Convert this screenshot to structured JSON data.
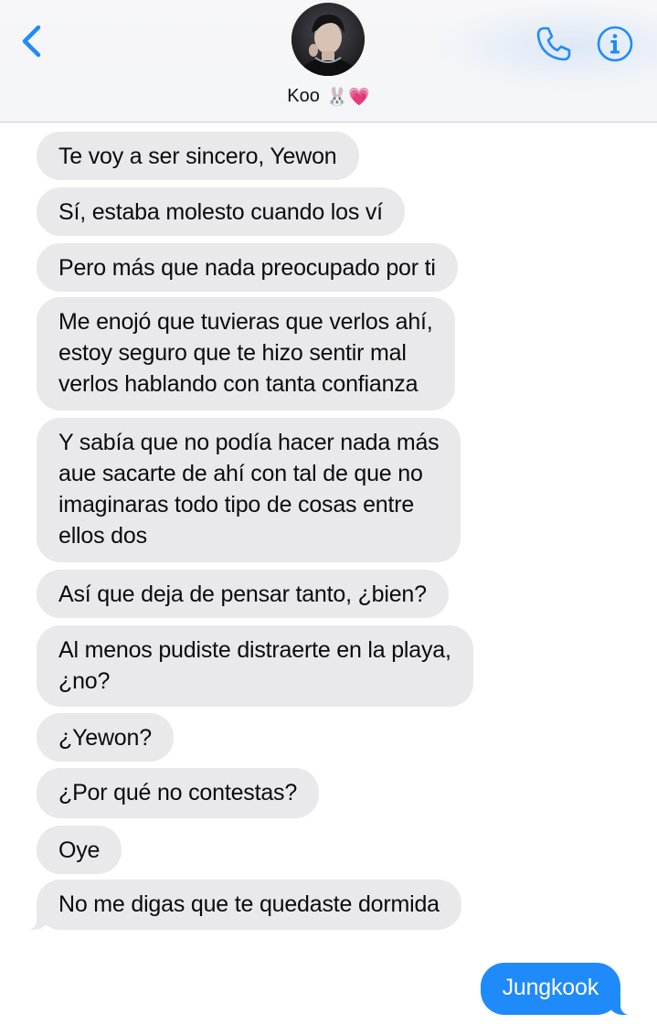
{
  "header": {
    "contact_name": "Koo",
    "contact_emojis": "🐰💗",
    "back_icon": "chevron-left-icon",
    "call_icon": "phone-icon",
    "info_icon": "info-icon",
    "accent_color": "#1f8bfa"
  },
  "messages": [
    {
      "text": "Te voy a ser sincero, Yewon"
    },
    {
      "text": "Sí, estaba molesto cuando los ví"
    },
    {
      "text": "Pero más que nada preocupado por ti"
    },
    {
      "text": "Me enojó que tuvieras que verlos ahí,\nestoy seguro que te hizo sentir mal\nverlos hablando con tanta confianza"
    },
    {
      "text": "Y sabía que no podía hacer nada más\naue sacarte de ahí con tal de que no\nimaginaras todo tipo de cosas entre\nellos dos"
    },
    {
      "text": "Así que deja de pensar tanto, ¿bien?"
    },
    {
      "text": "Al menos pudiste distraerte en la playa,\n¿no?"
    },
    {
      "text": "¿Yewon?"
    },
    {
      "text": "¿Por qué no contestas?"
    },
    {
      "text": "Oye"
    },
    {
      "text": "No me digas que te quedaste dormida"
    }
  ],
  "outgoing": {
    "text": "Jungkook",
    "bubble_color": "#1f8bfa"
  },
  "colors": {
    "incoming_bubble": "#e9e9eb",
    "outgoing_bubble": "#1f8bfa",
    "header_background": "#f6f6f8"
  }
}
